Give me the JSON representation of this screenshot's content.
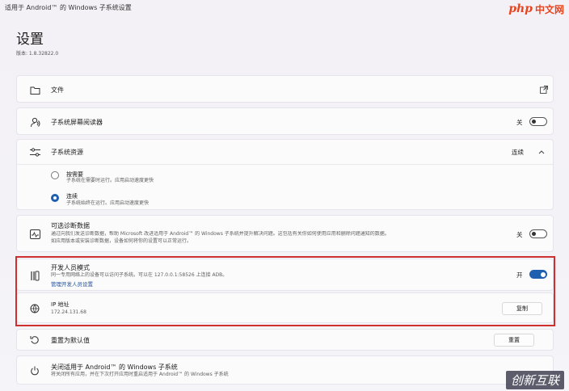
{
  "window": {
    "title": "适用于 Android™ 的 Windows 子系统设置"
  },
  "brand": {
    "php": "php",
    "cn": "中文网"
  },
  "page": {
    "title": "设置",
    "version": "版本: 1.8.32822.0"
  },
  "files": {
    "label": "文件",
    "icon": "folder-icon",
    "action_icon": "open-external-icon"
  },
  "screen_reader": {
    "label": "子系统屏幕阅读器",
    "state": "关"
  },
  "resources": {
    "label": "子系统资源",
    "value": "连续",
    "options": [
      {
        "title": "按需要",
        "desc": "子系统在需要时运行。应用启动速度更快",
        "selected": false
      },
      {
        "title": "连续",
        "desc": "子系统始终在运行。应用启动速度更快",
        "selected": true
      }
    ]
  },
  "diagnostics": {
    "label": "可选诊断数据",
    "desc1": "通过向我们发送诊断数据，帮助 Microsoft 改进适用于 Android™ 的 Windows 子系统并提升解决问题。这包括有关你如何使用应用和删除问题通知的数据。",
    "desc2": "如应用版本或安装诊断数据，设备如何将你的设置可以正常运行。",
    "state": "关"
  },
  "developer": {
    "label": "开发人员模式",
    "desc": "同一专用网络上的设备可以访问子系统。可以在 127.0.0.1:58526 上连接 ADB。",
    "link": "管理开发人员设置",
    "state": "开"
  },
  "ip": {
    "label": "IP 地址",
    "value": "172.24.131.68",
    "button": "复制"
  },
  "reset": {
    "label": "重置为默认值",
    "button": "重置"
  },
  "shutdown": {
    "label": "关闭适用于 Android™ 的 Windows 子系统",
    "desc": "将关闭所有应用，并在下次打开应用时重启适用于 Android™ 的 Windows 子系统"
  },
  "watermark": {
    "text": "创新互联"
  },
  "colors": {
    "accent": "#1f5fb0",
    "highlight": "#cf2f2f"
  }
}
